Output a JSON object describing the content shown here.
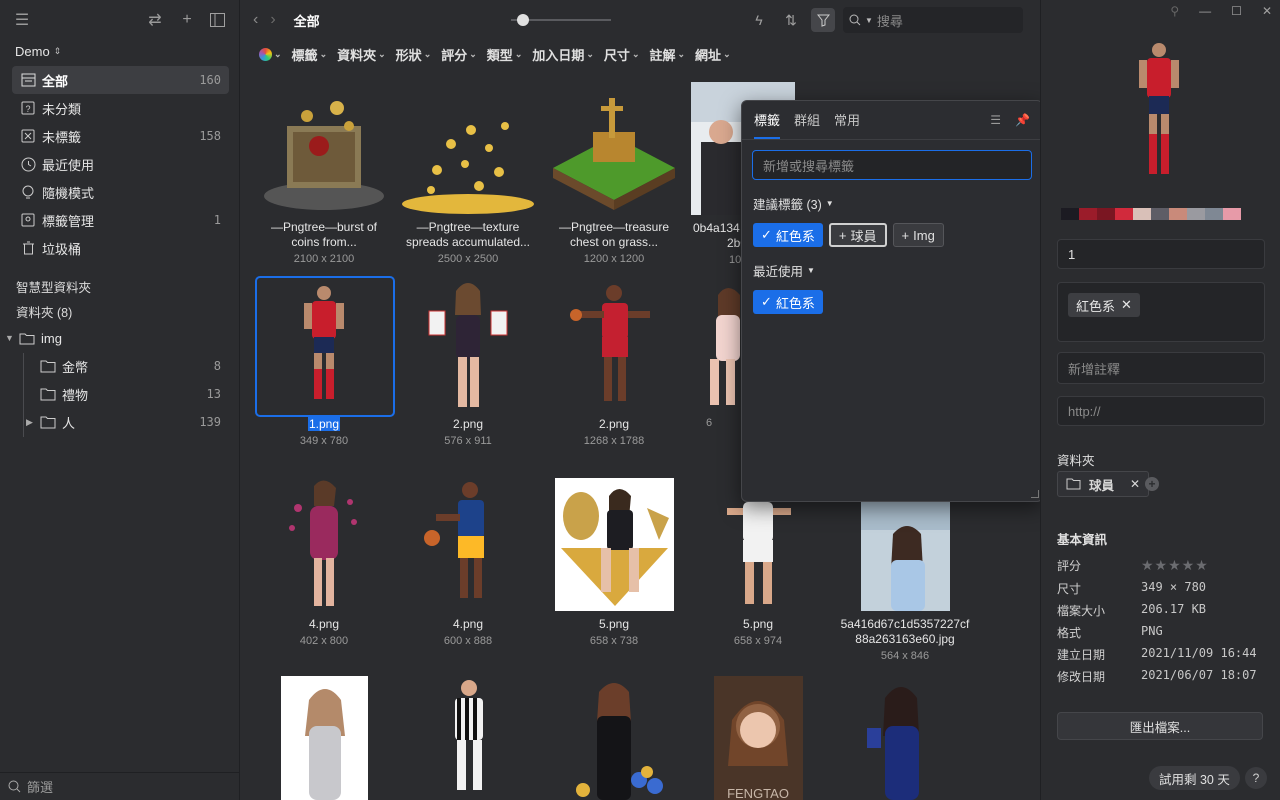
{
  "sidebar": {
    "library": "Demo",
    "nav": [
      {
        "label": "全部",
        "count": "160",
        "icon": "inbox-icon"
      },
      {
        "label": "未分類",
        "count": "",
        "icon": "uncategorized-icon"
      },
      {
        "label": "未標籤",
        "count": "158",
        "icon": "untagged-icon"
      },
      {
        "label": "最近使用",
        "count": "",
        "icon": "clock-icon"
      },
      {
        "label": "隨機模式",
        "count": "",
        "icon": "bulb-icon"
      },
      {
        "label": "標籤管理",
        "count": "1",
        "icon": "tag-manage-icon"
      },
      {
        "label": "垃圾桶",
        "count": "",
        "icon": "trash-icon"
      }
    ],
    "smart_folders": "智慧型資料夾",
    "folders_header": "資料夾 (8)",
    "folders": [
      {
        "label": "img",
        "count": ""
      },
      {
        "label": "金幣",
        "count": "8"
      },
      {
        "label": "禮物",
        "count": "13"
      },
      {
        "label": "人",
        "count": "139"
      }
    ],
    "filter_placeholder": "篩選"
  },
  "toolbar": {
    "title": "全部",
    "search_placeholder": "搜尋",
    "filters": [
      "標籤",
      "資料夾",
      "形狀",
      "評分",
      "類型",
      "加入日期",
      "尺寸",
      "註解",
      "網址"
    ]
  },
  "grid": [
    {
      "name1": "—Pngtree—burst of",
      "name2": "coins from...",
      "dims": "2100 x 2100"
    },
    {
      "name1": "—Pngtree—texture",
      "name2": "spreads accumulated...",
      "dims": "2500 x 2500"
    },
    {
      "name1": "—Pngtree—treasure",
      "name2": "chest on grass...",
      "dims": "1200 x 1200"
    },
    {
      "name1": "0b4a134",
      "name2": "2b04c",
      "dims": "10"
    },
    {
      "name1": "1.png",
      "name2": "",
      "dims": "349 x 780"
    },
    {
      "name1": "2.png",
      "name2": "",
      "dims": "576 x 911"
    },
    {
      "name1": "2.png",
      "name2": "",
      "dims": "1268 x 1788"
    },
    {
      "name1": "",
      "name2": "",
      "dims": "6"
    },
    {
      "name1": "4.png",
      "name2": "",
      "dims": "402 x 800"
    },
    {
      "name1": "4.png",
      "name2": "",
      "dims": "600 x 888"
    },
    {
      "name1": "5.png",
      "name2": "",
      "dims": "658 x 738"
    },
    {
      "name1": "5.png",
      "name2": "",
      "dims": "658 x 974"
    },
    {
      "name1": "5a416d67c1d5357227cf",
      "name2": "88a263163e60.jpg",
      "dims": "564 x 846"
    }
  ],
  "watermark_text": "FENGTAO",
  "tag_popup": {
    "tabs": [
      "標籤",
      "群組",
      "常用"
    ],
    "input_placeholder": "新增或搜尋標籤",
    "suggested_header": "建議標籤 (3)",
    "suggested": [
      {
        "label": "紅色系",
        "state": "selected"
      },
      {
        "label": "球員",
        "state": "add"
      },
      {
        "label": "Img",
        "state": "add"
      }
    ],
    "recent_header": "最近使用",
    "recent": [
      {
        "label": "紅色系",
        "state": "selected"
      }
    ]
  },
  "inspector": {
    "palette": [
      "#1c1b22",
      "#9b1c2a",
      "#7a1622",
      "#d12a3c",
      "#d9c0b8",
      "#5e5d66",
      "#c98a7a",
      "#9a9aa0",
      "#7f8894",
      "#e79aa8"
    ],
    "name_value": "1",
    "tag": "紅色系",
    "note_placeholder": "新增註釋",
    "url_placeholder": "http://",
    "folder_label": "資料夾",
    "folder_chip": "球員",
    "basic_info": "基本資訊",
    "info": {
      "rating_label": "評分",
      "rating": 0,
      "size_label": "尺寸",
      "size": "349 × 780",
      "filesize_label": "檔案大小",
      "filesize": "206.17 KB",
      "format_label": "格式",
      "format": "PNG",
      "created_label": "建立日期",
      "created": "2021/11/09 16:44",
      "modified_label": "修改日期",
      "modified": "2021/06/07 18:07"
    },
    "export_label": "匯出檔案...",
    "trial_label": "試用剩 30 天",
    "help_label": "?"
  }
}
